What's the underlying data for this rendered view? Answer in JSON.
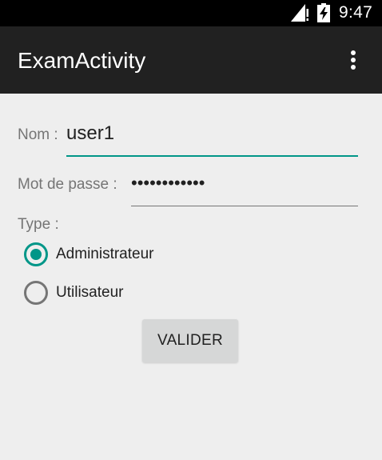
{
  "status_bar": {
    "time": "9:47",
    "icons": [
      "signal-icon",
      "battery-charging-icon"
    ]
  },
  "app_bar": {
    "title": "ExamActivity",
    "menu_icon": "more-vert-icon"
  },
  "form": {
    "nom": {
      "label": "Nom :",
      "value": "user1"
    },
    "password": {
      "label": "Mot de passe :",
      "value": "••••••••••••"
    },
    "type": {
      "label": "Type :",
      "options": [
        {
          "label": "Administrateur",
          "checked": true
        },
        {
          "label": "Utilisateur",
          "checked": false
        }
      ]
    },
    "submit_label": "VALIDER"
  },
  "colors": {
    "accent": "#009688",
    "app_bar": "#212121",
    "status_bar": "#000000",
    "background": "#EEEEEE",
    "button": "#D6D7D7"
  }
}
